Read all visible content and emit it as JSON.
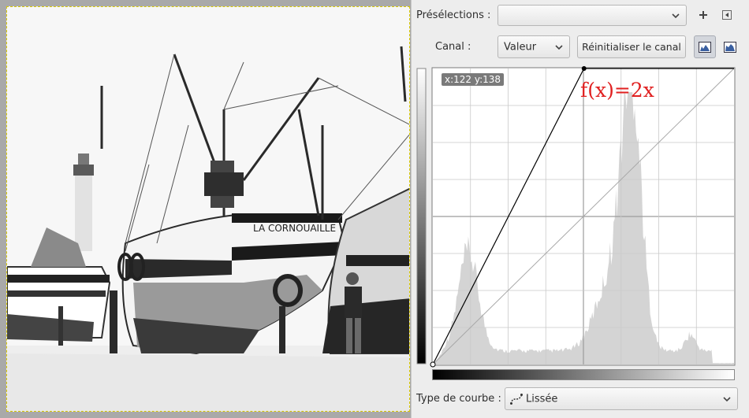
{
  "canvas": {
    "image_caption": "LA CORNOUAILLE"
  },
  "curves_dialog": {
    "presets": {
      "label": "Présélections :",
      "value": ""
    },
    "channel": {
      "label": "Canal :",
      "value": "Valeur"
    },
    "reset_button": "Réinitialiser le canal",
    "cursor_readout": "x:122 y:138",
    "annotation": "f(x)=2x",
    "curve_type": {
      "label": "Type de courbe :",
      "value": "Lissée"
    },
    "icons": {
      "add_preset": "plus-icon",
      "preset_menu": "menu-arrow-icon",
      "linear_histogram": "linear-histogram-icon",
      "log_histogram": "log-histogram-icon",
      "curve_type": "smooth-curve-icon"
    },
    "curve": {
      "points": [
        [
          0,
          0
        ],
        [
          128,
          255
        ],
        [
          255,
          255
        ]
      ],
      "histogram_color": "#d4d4d4",
      "grid_color": "#c9c9c9",
      "line_color": "#000000"
    }
  }
}
